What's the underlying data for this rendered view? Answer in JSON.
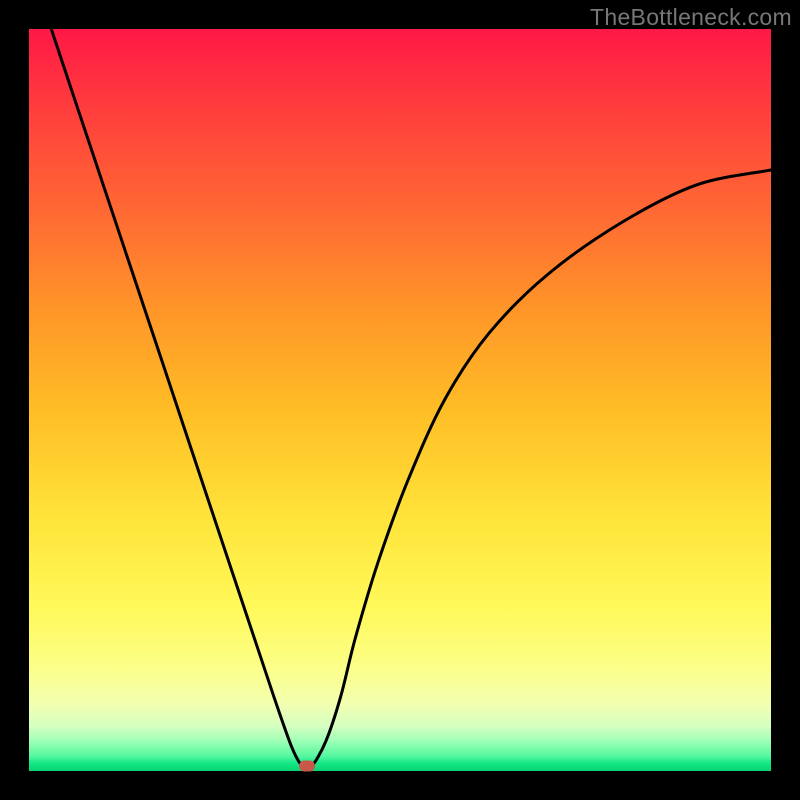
{
  "watermark": "TheBottleneck.com",
  "chart_data": {
    "type": "line",
    "title": "",
    "xlabel": "",
    "ylabel": "",
    "xlim": [
      0,
      100
    ],
    "ylim": [
      0,
      100
    ],
    "grid": false,
    "legend": false,
    "series": [
      {
        "name": "curve",
        "x": [
          3,
          6,
          10,
          14,
          18,
          22,
          26,
          30,
          33,
          35.5,
          37,
          38,
          40,
          42,
          44,
          47,
          51,
          56,
          62,
          70,
          80,
          90,
          100
        ],
        "y": [
          100,
          91,
          79,
          67,
          55,
          43,
          31,
          19,
          10,
          3,
          0.5,
          0.5,
          4,
          10,
          18,
          28,
          39,
          50,
          59,
          67,
          74,
          79,
          81
        ]
      }
    ],
    "marker": {
      "x": 37.5,
      "y": 0.7
    },
    "background_gradient": {
      "top": "#ff1846",
      "mid": "#ffe43a",
      "bottom": "#0ad373"
    }
  }
}
